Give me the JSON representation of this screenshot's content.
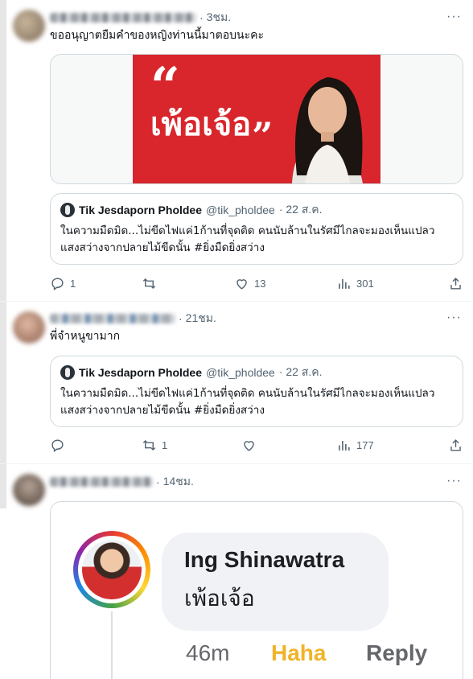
{
  "tweets": [
    {
      "time": "3ชม.",
      "text": "ขออนุญาตยืมคำของหญิงท่านนี้มาตอบนะคะ",
      "image": {
        "quote_open": "“",
        "word": "เพ้อเจ้อ",
        "quote_close": "”"
      },
      "actions": {
        "reply": "1",
        "retweet": "",
        "like": "13",
        "views": "301"
      }
    },
    {
      "time": "21ชม.",
      "text": "พี่จำหนูขามาก",
      "actions": {
        "reply": "",
        "retweet": "1",
        "like": "",
        "views": "177"
      }
    },
    {
      "time": "14ชม.",
      "fb_comment": {
        "author": "Ing Shinawatra",
        "comment": "เพ้อเจ้อ",
        "time": "46m",
        "haha": "Haha",
        "reply": "Reply"
      }
    }
  ],
  "quoted": {
    "name": "Tik Jesdaporn Pholdee",
    "handle": "@tik_pholdee",
    "date": "· 22 ส.ค.",
    "line1": "ในความมืดมิด...ไม่ขีดไฟแค่1ก้านที่จุดติด คนนับล้านในรัศมีไกลจะมองเห็นแปลว",
    "line2": "แสงสว่างจากปลายไม้ขีดนั้น #ยิ่งมืดยิ่งสว่าง"
  },
  "more_label": "···",
  "colors": {
    "red": "#d8262c",
    "haha": "#f0b429",
    "meta_gray": "#65676b"
  }
}
